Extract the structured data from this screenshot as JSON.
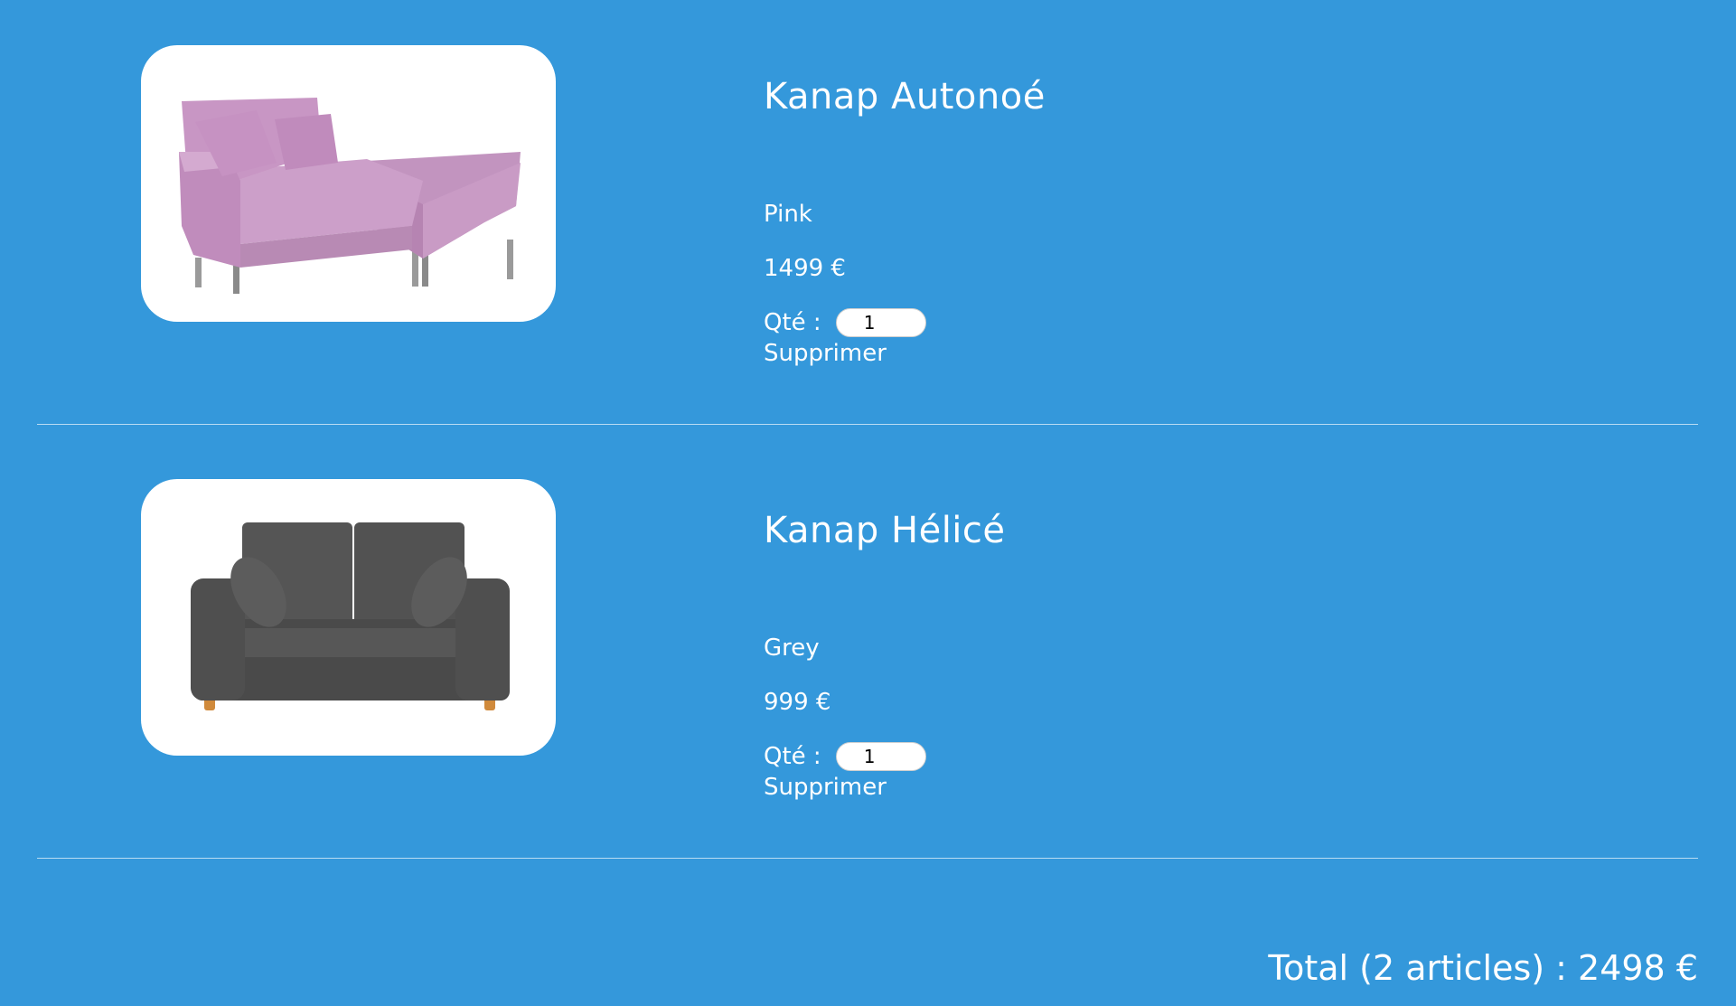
{
  "cart": {
    "items": [
      {
        "name": "Kanap Autonoé",
        "color": "Pink",
        "price": "1499 €",
        "quantity_label": "Qté :",
        "quantity_value": "1",
        "delete_label": "Supprimer",
        "image_icon": "pink-chaise-sofa-image",
        "sofa_color": "#c996c4"
      },
      {
        "name": "Kanap Hélicé",
        "color": "Grey",
        "price": "999 €",
        "quantity_label": "Qté :",
        "quantity_value": "1",
        "delete_label": "Supprimer",
        "image_icon": "grey-loveseat-sofa-image",
        "sofa_color": "#505050"
      }
    ],
    "total": "Total (2 articles) : 2498 €"
  },
  "colors": {
    "background": "#3498db",
    "text": "#ffffff",
    "card": "#ffffff",
    "divider": "#b9dcf3"
  }
}
